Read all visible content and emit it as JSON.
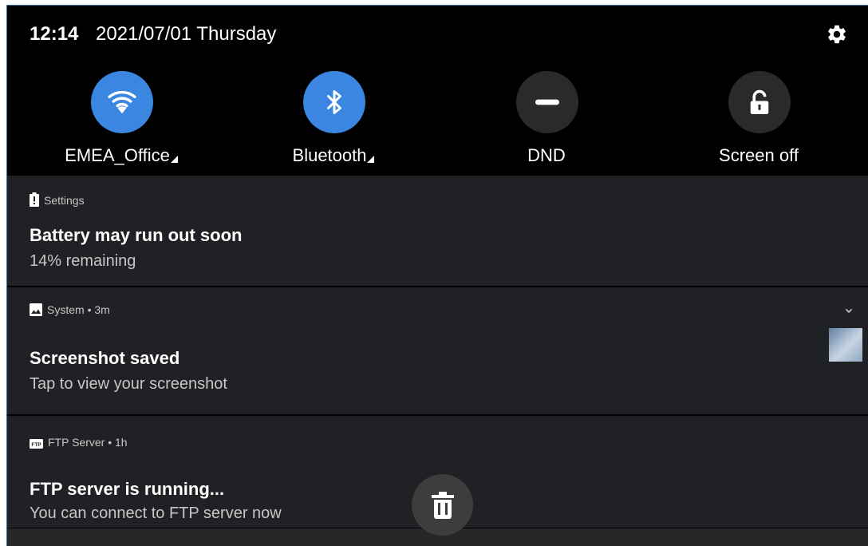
{
  "status_bar": {
    "time": "12:14",
    "date": "2021/07/01 Thursday",
    "settings_icon": "gear-icon"
  },
  "quick_settings": {
    "tiles": [
      {
        "label": "EMEA_Office",
        "icon": "wifi-icon",
        "active": true,
        "has_caret": true
      },
      {
        "label": "Bluetooth",
        "icon": "bluetooth-icon",
        "active": true,
        "has_caret": true
      },
      {
        "label": "DND",
        "icon": "dnd-icon",
        "active": false,
        "has_caret": false
      },
      {
        "label": "Screen off",
        "icon": "lock-icon",
        "active": false,
        "has_caret": false
      }
    ]
  },
  "notifications": [
    {
      "app": "Settings",
      "icon": "battery-alert-icon",
      "title": "Battery may run out soon",
      "text": "14% remaining"
    },
    {
      "app": "System • 3m",
      "icon": "image-icon",
      "title": "Screenshot saved",
      "text": "Tap to view your screenshot"
    },
    {
      "app": "FTP Server • 1h",
      "icon": "ftp-icon",
      "title": "FTP server is running...",
      "text": "You can connect to FTP server now"
    }
  ],
  "clear_all_icon": "trash-icon",
  "colors": {
    "accent": "#3a86e0",
    "background": "#000000",
    "card": "#202124"
  }
}
